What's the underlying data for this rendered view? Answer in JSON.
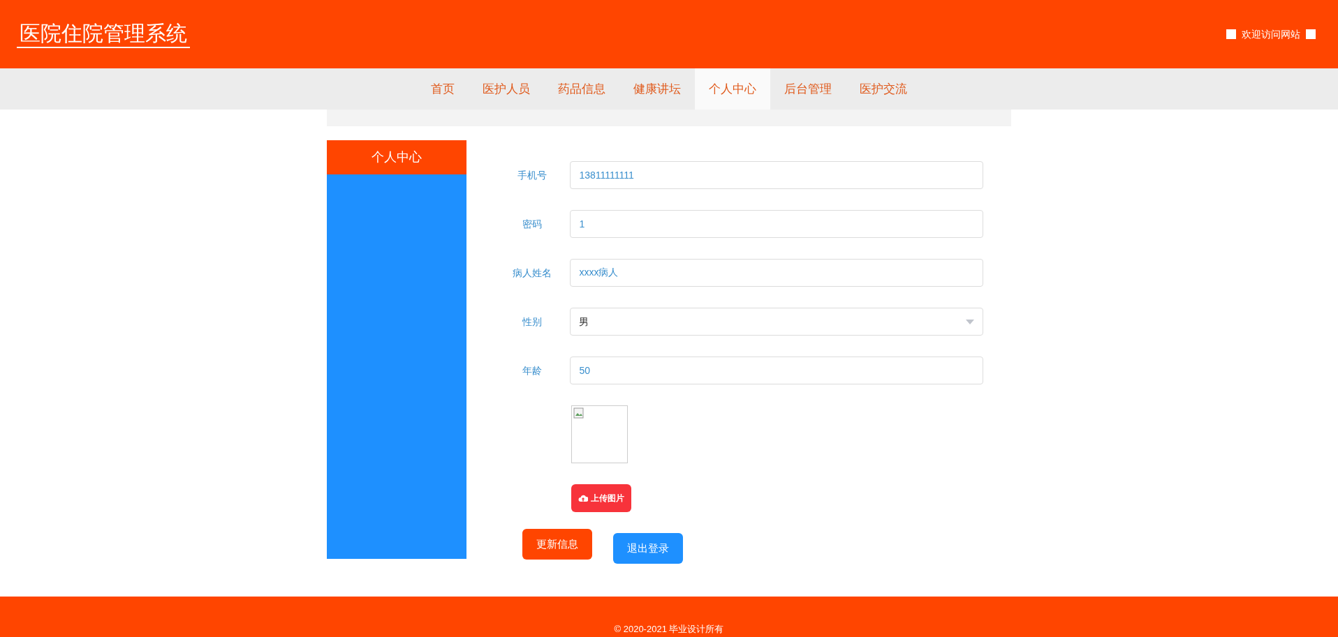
{
  "header": {
    "title": "医院住院管理系统",
    "welcome": "欢迎访问网站"
  },
  "nav": [
    {
      "label": "首页",
      "selected": false
    },
    {
      "label": "医护人员",
      "selected": false
    },
    {
      "label": "药品信息",
      "selected": false
    },
    {
      "label": "健康讲坛",
      "selected": false
    },
    {
      "label": "个人中心",
      "selected": true
    },
    {
      "label": "后台管理",
      "selected": false
    },
    {
      "label": "医护交流",
      "selected": false
    }
  ],
  "sidebar": {
    "title": "个人中心"
  },
  "form": {
    "fields": [
      {
        "kind": "text",
        "label": "手机号",
        "value": "13811111111"
      },
      {
        "kind": "text",
        "label": "密码",
        "value": "1"
      },
      {
        "kind": "text",
        "label": "病人姓名",
        "value": "xxxx病人"
      },
      {
        "kind": "select",
        "label": "性别",
        "value": "男"
      },
      {
        "kind": "text",
        "label": "年龄",
        "value": "50"
      }
    ],
    "upload_button": "上传图片"
  },
  "buttons": {
    "update": "更新信息",
    "logout": "退出登录"
  },
  "footer": "© 2020-2021 毕业设计所有"
}
